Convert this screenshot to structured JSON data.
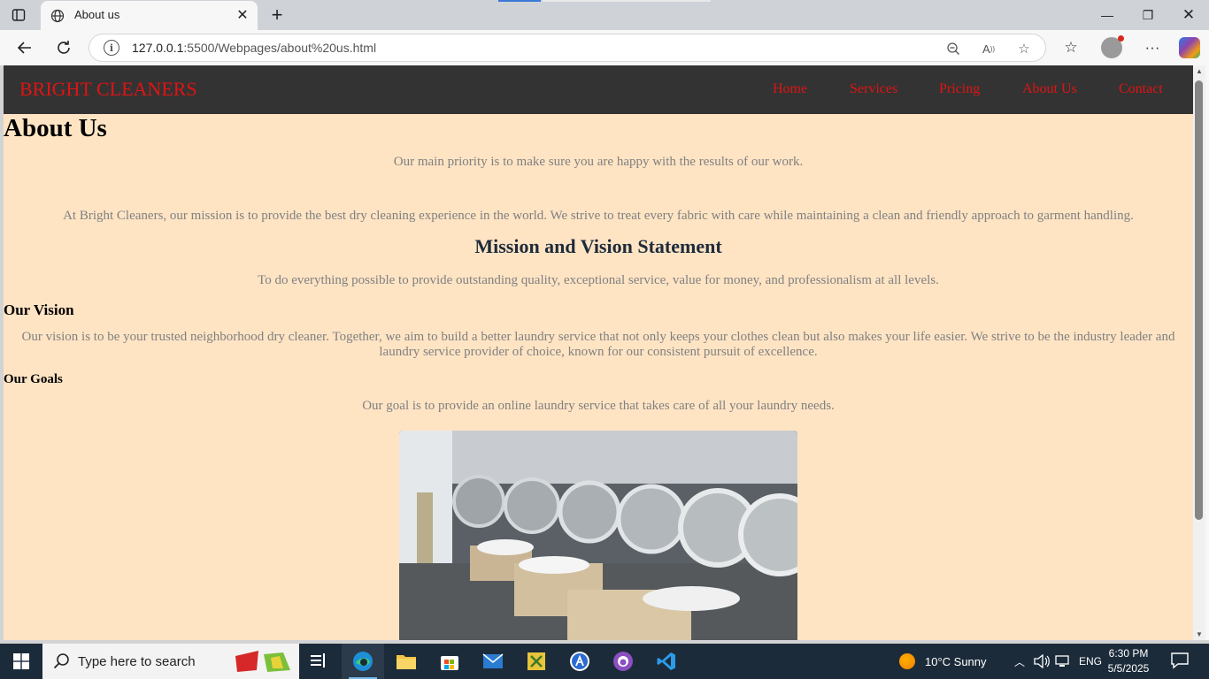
{
  "browser": {
    "tab_title": "About us",
    "url_host": "127.0.0.1",
    "url_rest": ":5500/Webpages/about%20us.html"
  },
  "site": {
    "brand": "BRIGHT CLEANERS",
    "nav": [
      "Home",
      "Services",
      "Pricing",
      "About Us",
      "Contact"
    ],
    "colors": {
      "nav_bg": "#333333",
      "accent": "#e11313",
      "page_bg": "#ffe4c4"
    }
  },
  "page": {
    "heading": "About Us",
    "intro": "Our main priority is to make sure you are happy with the results of our work.",
    "mission_paragraph": "At Bright Cleaners, our mission is to provide the best dry cleaning experience in the world. We strive to treat every fabric with care while maintaining a clean and friendly approach to garment handling.",
    "mission_heading": "Mission and Vision Statement",
    "mission_statement": "To do everything possible to provide outstanding quality, exceptional service, value for money, and professionalism at all levels.",
    "vision_heading": "Our Vision",
    "vision_text": "Our vision is to be your trusted neighborhood dry cleaner. Together, we aim to build a better laundry service that not only keeps your clothes clean but also makes your life easier. We strive to be the industry leader and laundry service provider of choice, known for our consistent pursuit of excellence.",
    "goals_heading": "Our Goals",
    "goals_text": "Our goal is to provide an online laundry service that takes care of all your laundry needs."
  },
  "taskbar": {
    "search_placeholder": "Type here to search",
    "weather": "10°C  Sunny",
    "language": "ENG",
    "time": "6:30 PM",
    "date": "5/5/2025"
  }
}
